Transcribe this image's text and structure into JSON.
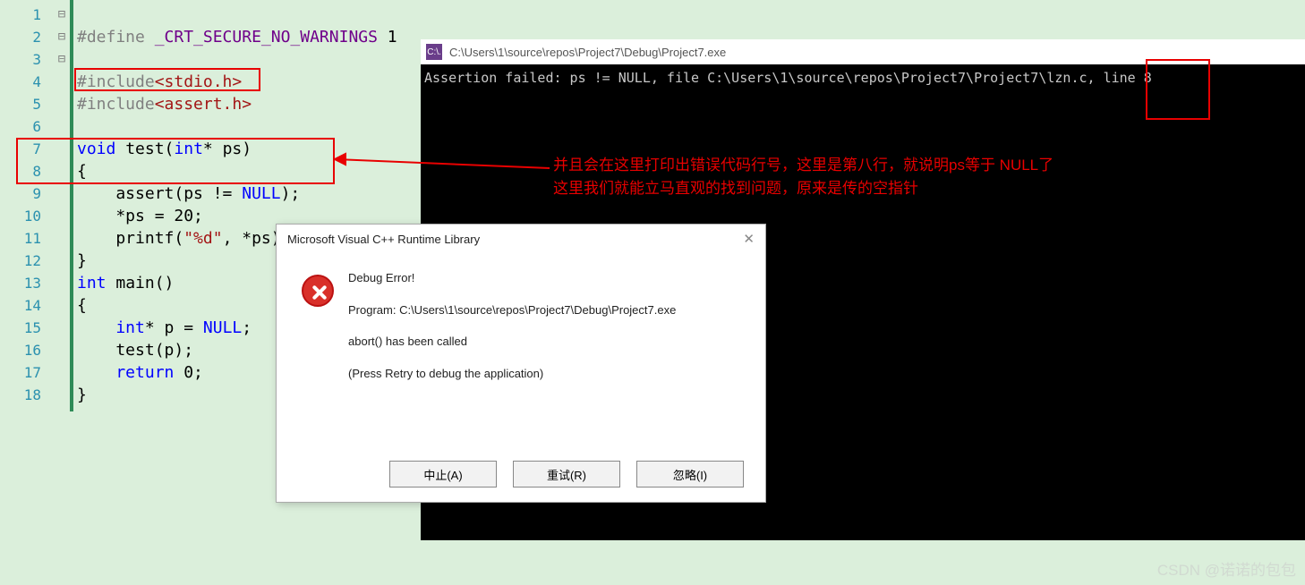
{
  "editor": {
    "line_numbers": [
      "1",
      "2",
      "3",
      "4",
      "5",
      "6",
      "7",
      "8",
      "9",
      "10",
      "11",
      "12",
      "13",
      "14",
      "15",
      "16",
      "17",
      "18"
    ],
    "fold_markers": {
      "3": "⊟",
      "6": "⊟",
      "12": "⊟"
    },
    "lines": {
      "l1_define": "#define",
      "l1_macro": "_CRT_SECURE_NO_WARNINGS",
      "l1_val": "1",
      "l3_include": "#include",
      "l3_hdr": "<stdio.h>",
      "l4_include": "#include",
      "l4_hdr": "<assert.h>",
      "l6_void": "void",
      "l6_name": " test(",
      "l6_int": "int",
      "l6_rest": "* ps)",
      "l7": "{",
      "l8_assert": "    assert(ps != ",
      "l8_null": "NULL",
      "l8_end": ");",
      "l9": "    *ps = 20;",
      "l10_printf": "    printf(",
      "l10_fmt": "\"%d\"",
      "l10_rest": ", *ps);",
      "l11": "}",
      "l12_int": "int",
      "l12_main": " main()",
      "l13": "{",
      "l14_int": "    int",
      "l14_rest": "* p = ",
      "l14_null": "NULL",
      "l14_end": ";",
      "l15": "    test(p);",
      "l16_return": "    return",
      "l16_val": " 0;",
      "l17": "}"
    }
  },
  "console": {
    "icon_text": "C:\\.",
    "title": "C:\\Users\\1\\source\\repos\\Project7\\Debug\\Project7.exe",
    "output": "Assertion failed: ps != NULL, file C:\\Users\\1\\source\\repos\\Project7\\Project7\\lzn.c, line 8"
  },
  "annotation": {
    "line1": "并且会在这里打印出错误代码行号，这里是第八行，就说明ps等于 NULL了",
    "line2": "这里我们就能立马直观的找到问题，原来是传的空指针"
  },
  "dialog": {
    "title": "Microsoft Visual C++ Runtime Library",
    "heading": "Debug Error!",
    "program": "Program: C:\\Users\\1\\source\\repos\\Project7\\Debug\\Project7.exe",
    "abort": "abort() has been called",
    "retry_hint": "(Press Retry to debug the application)",
    "btn_abort": "中止(A)",
    "btn_retry": "重试(R)",
    "btn_ignore": "忽略(I)"
  },
  "watermark": "CSDN @诺诺的包包"
}
